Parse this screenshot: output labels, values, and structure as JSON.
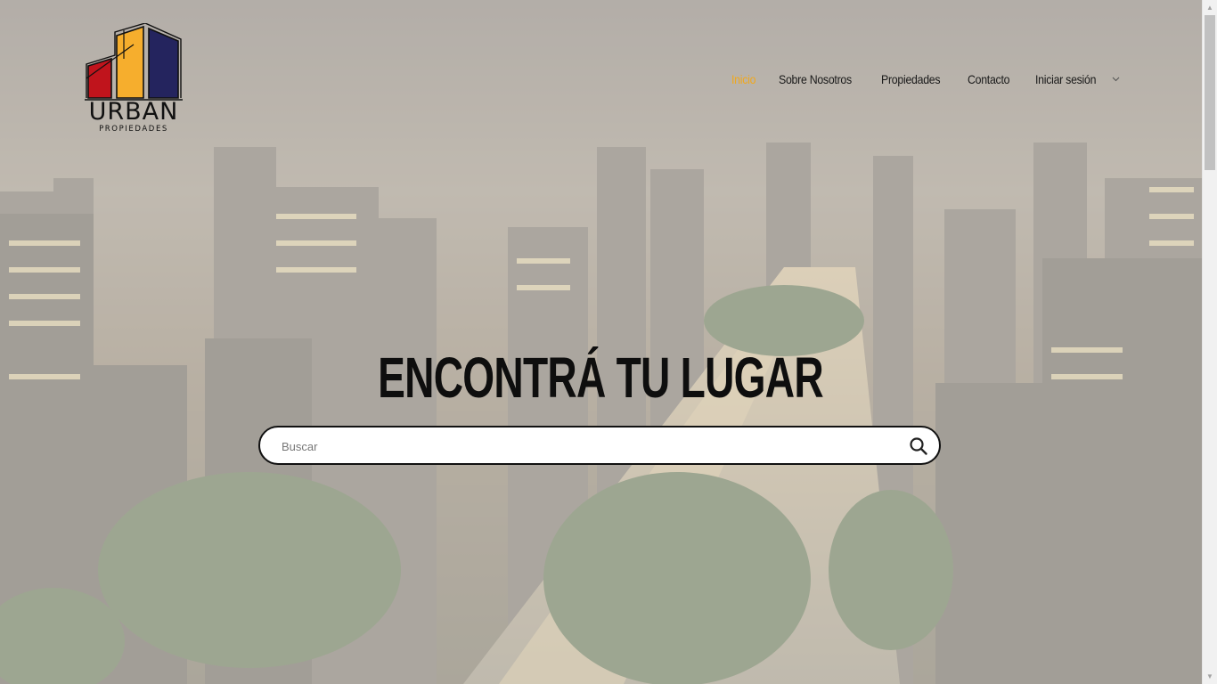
{
  "brand": {
    "name": "URBAN",
    "tagline": "PROPIEDADES"
  },
  "nav": {
    "items": [
      {
        "label": "Inicio",
        "active": true
      },
      {
        "label": "Sobre Nosotros",
        "active": false
      },
      {
        "label": "Propiedades",
        "active": false
      },
      {
        "label": "Contacto",
        "active": false
      },
      {
        "label": "Iniciar sesión",
        "active": false,
        "has_dropdown": true
      }
    ]
  },
  "hero": {
    "headline": "ENCONTRÁ TU LUGAR",
    "background": "city-night-skyline-image"
  },
  "search": {
    "placeholder": "Buscar",
    "value": "",
    "icon": "search-icon"
  },
  "colors": {
    "accent": "#f0a81e",
    "logo_red": "#c0141c",
    "logo_yellow": "#f6ae2d",
    "logo_navy": "#24245e"
  }
}
